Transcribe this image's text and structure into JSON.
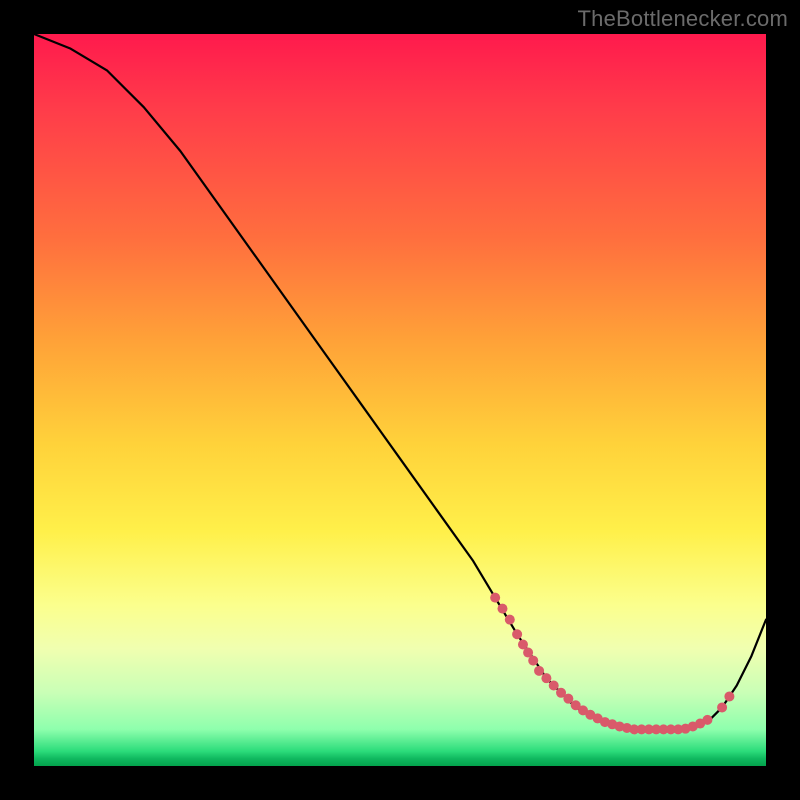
{
  "attribution": "TheBottlenecker.com",
  "chart_data": {
    "type": "line",
    "title": "",
    "xlabel": "",
    "ylabel": "",
    "xlim": [
      0,
      100
    ],
    "ylim": [
      0,
      100
    ],
    "series": [
      {
        "name": "curve",
        "x": [
          0,
          5,
          10,
          15,
          20,
          25,
          30,
          35,
          40,
          45,
          50,
          55,
          60,
          63,
          66,
          68,
          70,
          72,
          74,
          76,
          78,
          80,
          82,
          84,
          86,
          88,
          90,
          92,
          94,
          96,
          98,
          100
        ],
        "y": [
          100,
          98,
          95,
          90,
          84,
          77,
          70,
          63,
          56,
          49,
          42,
          35,
          28,
          23,
          18,
          15,
          12,
          10,
          8,
          7,
          6,
          5.5,
          5,
          5,
          5,
          5,
          5.5,
          6,
          8,
          11,
          15,
          20
        ]
      }
    ],
    "markers": {
      "name": "dots",
      "x": [
        63,
        64,
        65,
        66,
        66.8,
        67.5,
        68.2,
        69,
        70,
        71,
        72,
        73,
        74,
        75,
        76,
        77,
        78,
        79,
        80,
        81,
        82,
        83,
        84,
        85,
        86,
        87,
        88,
        89,
        90,
        91,
        92,
        94,
        95
      ],
      "y": [
        23,
        21.5,
        20,
        18,
        16.6,
        15.5,
        14.4,
        13,
        12,
        11,
        10,
        9.2,
        8.3,
        7.6,
        7,
        6.5,
        6,
        5.7,
        5.4,
        5.2,
        5,
        5,
        5,
        5,
        5,
        5,
        5,
        5.1,
        5.4,
        5.8,
        6.3,
        8,
        9.5
      ],
      "color": "#d95a6a",
      "radius": 5
    },
    "background_gradient": {
      "top": "#ff1a4d",
      "mid": "#fff04a",
      "bottom": "#03a34c"
    }
  }
}
